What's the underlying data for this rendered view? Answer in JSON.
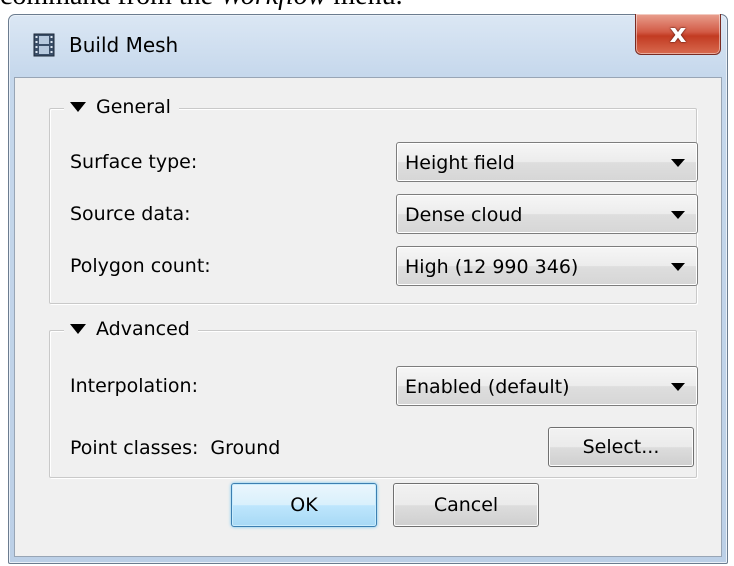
{
  "document": {
    "caption_prefix": "command from the ",
    "caption_emph": "Workflow",
    "caption_suffix": " menu."
  },
  "dialog": {
    "title": "Build Mesh",
    "close_label": "x",
    "app_icon": "film-strip-icon"
  },
  "general": {
    "legend": "General",
    "surface_type": {
      "label": "Surface type:",
      "value": "Height field"
    },
    "source_data": {
      "label": "Source data:",
      "value": "Dense cloud"
    },
    "polygon_count": {
      "label": "Polygon count:",
      "value": "High (12 990 346)"
    }
  },
  "advanced": {
    "legend": "Advanced",
    "interpolation": {
      "label": "Interpolation:",
      "value": "Enabled (default)"
    },
    "point_classes": {
      "label": "Point classes:",
      "value": "Ground"
    },
    "select_button": "Select..."
  },
  "buttons": {
    "ok": "OK",
    "cancel": "Cancel"
  },
  "colors": {
    "title_gradient_top": "#dbe7f4",
    "title_gradient_bottom": "#bcd0e7",
    "close_button": "#c23b22",
    "client_background": "#f0f0f0",
    "default_button_border": "#3c7fb1"
  }
}
